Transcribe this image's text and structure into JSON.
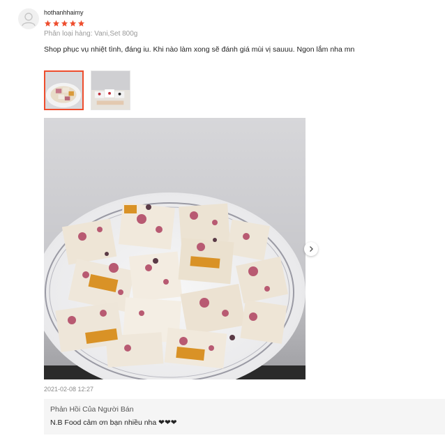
{
  "review": {
    "username": "hothanhhaimy",
    "rating": 5,
    "variant": "Phân loại hàng: Vani,Set 800g",
    "comment": "Shop phục vụ nhiệt tình, đáng iu. Khi nào làm xong sẽ đánh giá mùi vị sauuu. Ngon lắm nha mn",
    "timestamp": "2021-02-08 12:27",
    "thumbnails": [
      {
        "selected": true
      },
      {
        "selected": false
      }
    ]
  },
  "seller_reply": {
    "title": "Phản Hồi Của Người Bán",
    "text": "N.B Food cảm ơn bạn nhiều nha ❤❤❤"
  },
  "colors": {
    "accent": "#ee4d2d",
    "reply_bg": "#f5f5f5"
  },
  "icons": [
    "user-avatar-icon",
    "star-icon",
    "chevron-right-icon"
  ]
}
